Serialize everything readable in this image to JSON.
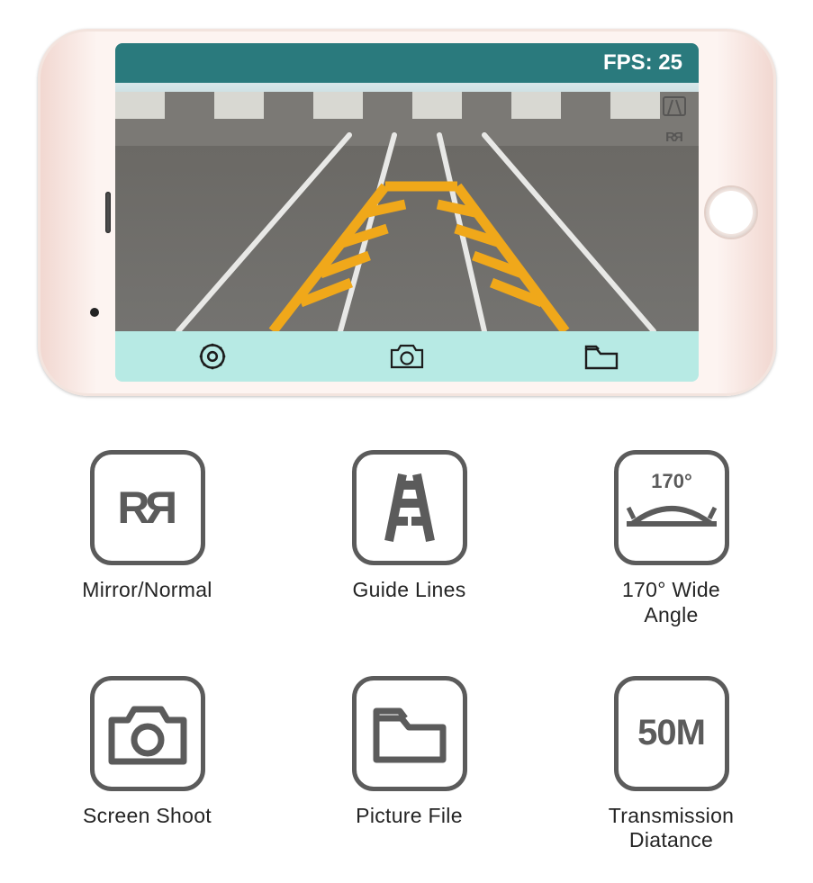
{
  "screen": {
    "fps_label": "FPS: 25",
    "toolbar": {
      "settings": "settings",
      "screenshot": "screenshot",
      "folder": "folder"
    },
    "overlay_icons": {
      "guidelines": "guidelines",
      "mirror": "mirror"
    }
  },
  "features": [
    {
      "id": "mirror",
      "label": "Mirror/Normal"
    },
    {
      "id": "guidelines",
      "label": "Guide Lines"
    },
    {
      "id": "wide-angle",
      "label": "170° Wide Angle",
      "badge": "170°"
    },
    {
      "id": "screenshot",
      "label": "Screen Shoot"
    },
    {
      "id": "picture-file",
      "label": "Picture File"
    },
    {
      "id": "transmission",
      "label": "Transmission Diatance",
      "badge": "50M"
    }
  ]
}
